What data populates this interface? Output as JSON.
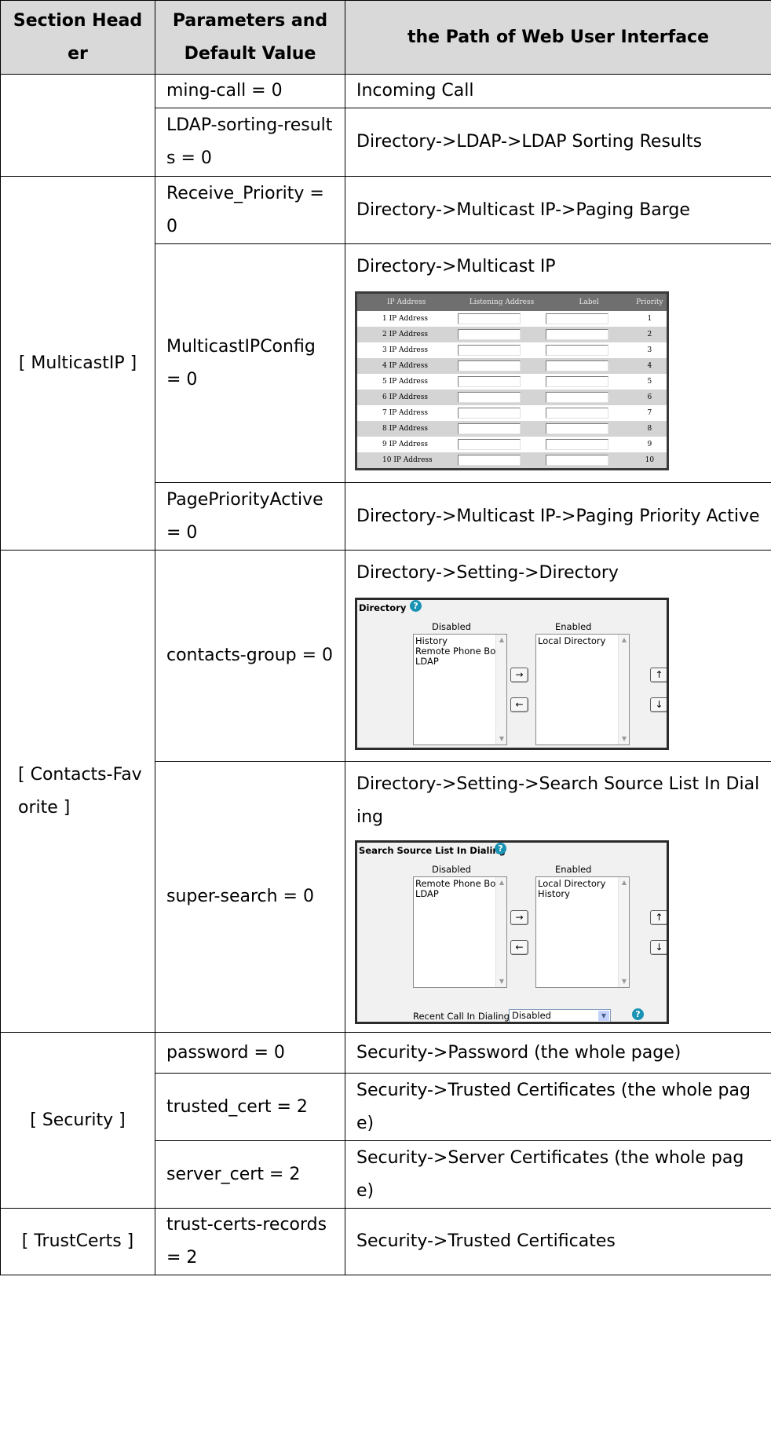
{
  "headers": [
    "Section Header",
    "Parameters and Default Value",
    "the Path of Web User Interface"
  ],
  "rows": {
    "r1": {
      "param": "ming-call = 0",
      "path": "Incoming Call"
    },
    "r2": {
      "param": "LDAP-sorting-results = 0",
      "path": "Directory->LDAP->LDAP Sorting Results"
    },
    "multicast_section": "[ MulticastIP ]",
    "r3": {
      "param": "Receive_Priority = 0",
      "path": "Directory->Multicast IP->Paging Barge"
    },
    "r4": {
      "param": "MulticastIPConfig = 0",
      "path": "Directory->Multicast IP"
    },
    "r5": {
      "param": "PagePriorityActive = 0",
      "path": "Directory->Multicast IP->Paging Priority Active"
    },
    "contacts_section": "[ Contacts-Favorite ]",
    "r6": {
      "param": "contacts-group = 0",
      "path": "Directory->Setting->Directory"
    },
    "r7": {
      "param": "super-search = 0",
      "path": "Directory->Setting->Search Source List In Dialing"
    },
    "security_section": "[ Security ]",
    "r8": {
      "param": "password = 0",
      "path": "Security->Password (the whole page)"
    },
    "r9": {
      "param": "trusted_cert = 2",
      "path": "Security->Trusted Certificates (the whole page)"
    },
    "r10": {
      "param": "server_cert = 2",
      "path": "Security->Server Certificates (the whole page)"
    },
    "trustcerts_section": "[ TrustCerts ]",
    "r11": {
      "param": "trust-certs-records = 2",
      "path": "Security->Trusted Certificates"
    }
  },
  "multicast_table": {
    "headers": [
      "IP Address",
      "Listening Address",
      "Label",
      "Priority"
    ],
    "rows": [
      {
        "name": "1  IP Address",
        "priority": "1"
      },
      {
        "name": "2  IP Address",
        "priority": "2"
      },
      {
        "name": "3  IP Address",
        "priority": "3"
      },
      {
        "name": "4  IP Address",
        "priority": "4"
      },
      {
        "name": "5  IP Address",
        "priority": "5"
      },
      {
        "name": "6  IP Address",
        "priority": "6"
      },
      {
        "name": "7  IP Address",
        "priority": "7"
      },
      {
        "name": "8  IP Address",
        "priority": "8"
      },
      {
        "name": "9  IP Address",
        "priority": "9"
      },
      {
        "name": "10  IP Address",
        "priority": "10"
      }
    ]
  },
  "directory_box": {
    "title": "Directory",
    "disabled_label": "Disabled",
    "enabled_label": "Enabled",
    "disabled_items": [
      "History",
      "Remote Phone Bool",
      "LDAP"
    ],
    "enabled_items": [
      "Local Directory"
    ],
    "right_arrow": "→",
    "left_arrow": "←",
    "up_arrow": "↑",
    "down_arrow": "↓"
  },
  "search_box": {
    "title": "Search Source List In Dialing",
    "disabled_label": "Disabled",
    "enabled_label": "Enabled",
    "disabled_items": [
      "Remote Phone Bool",
      "LDAP"
    ],
    "enabled_items": [
      "Local Directory",
      "History"
    ],
    "recent_label": "Recent Call In Dialing",
    "recent_value": "Disabled",
    "right_arrow": "→",
    "left_arrow": "←",
    "up_arrow": "↑",
    "down_arrow": "↓"
  },
  "icons": {
    "help": "question-circle-icon",
    "help_color": "#1a93b5"
  }
}
